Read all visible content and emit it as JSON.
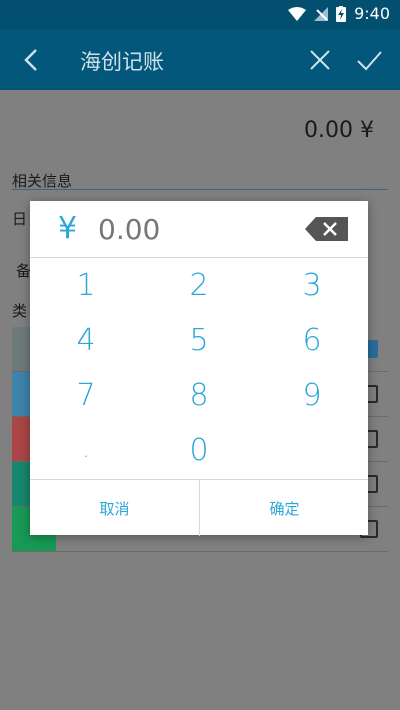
{
  "status": {
    "time": "9:40"
  },
  "toolbar": {
    "title": "海创记账"
  },
  "amount_display": "0.00 ¥",
  "section": {
    "label": "相关信息",
    "row1": "日",
    "row2": "备",
    "row3": "类"
  },
  "categories": [
    {
      "color": "#6f7b7b",
      "checked": true
    },
    {
      "color": "#3f84ad",
      "checked": false
    },
    {
      "color": "#aa4646",
      "checked": false
    },
    {
      "color": "#16876d",
      "checked": false
    },
    {
      "color": "#179a55",
      "checked": false
    }
  ],
  "dialog": {
    "currency": "¥",
    "value": "0.00",
    "keys": [
      "1",
      "2",
      "3",
      "4",
      "5",
      "6",
      "7",
      "8",
      "9",
      ".",
      "0"
    ],
    "cancel": "取消",
    "confirm": "确定"
  }
}
